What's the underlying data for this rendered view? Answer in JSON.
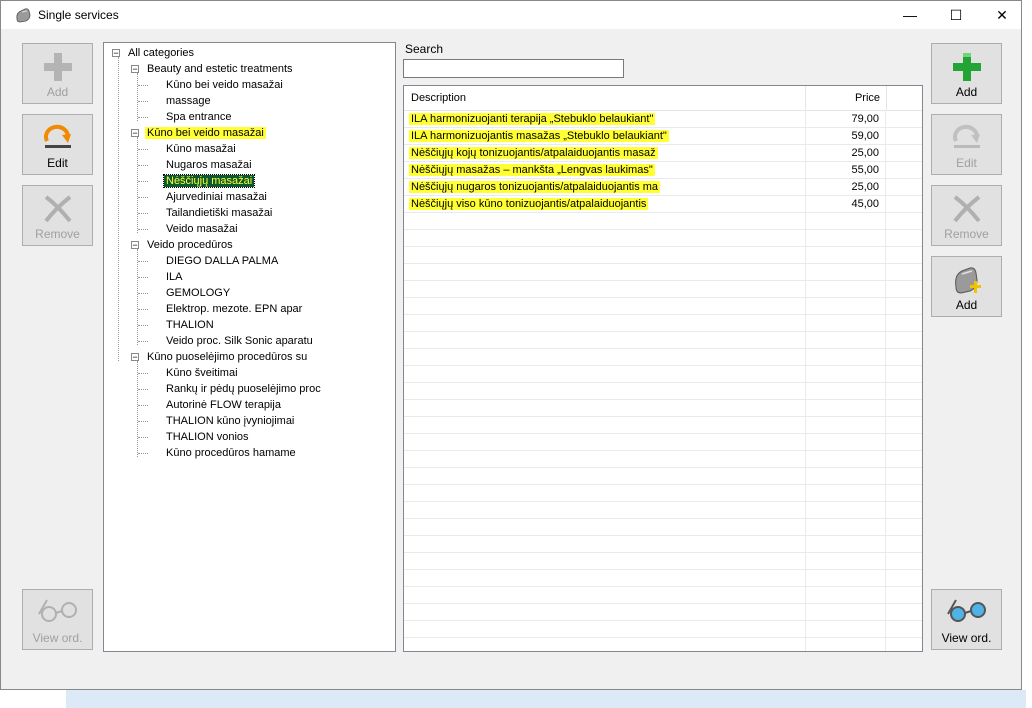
{
  "window": {
    "title": "Single services",
    "controls": {
      "minimize": "—",
      "maximize": "☐",
      "close": "✕"
    }
  },
  "left_buttons": {
    "add": "Add",
    "edit": "Edit",
    "remove": "Remove",
    "view_ord": "View ord."
  },
  "right_buttons": {
    "add": "Add",
    "edit": "Edit",
    "remove": "Remove",
    "add_item": "Add",
    "view_ord": "View ord."
  },
  "tree": {
    "root": "All categories",
    "groups": [
      {
        "label": "Beauty and estetic treatments",
        "children": [
          "Kūno bei veido masažai",
          "massage",
          "Spa entrance"
        ]
      },
      {
        "label": "Kūno bei veido masažai",
        "children": [
          "Kūno masažai",
          "Nugaros masažai",
          "Nėščiųjų masažai",
          "Ajurvediniai masažai",
          "Tailandietiški masažai",
          "Veido masažai"
        ]
      },
      {
        "label": "Veido procedūros",
        "children": [
          "DIEGO DALLA PALMA",
          "ILA",
          "GEMOLOGY",
          "Elektrop. mezote. EPN apar",
          "THALION",
          "Veido proc. Silk Sonic aparatu"
        ]
      },
      {
        "label": "Kūno puoselėjimo procedūros su",
        "children": [
          "Kūno šveitimai",
          "Rankų ir pėdų puoselėjimo proc",
          "Autorinė FLOW terapija",
          "THALION kūno įvyniojimai",
          "THALION vonios",
          "Kūno procedūros hamame"
        ]
      }
    ],
    "selected": "Nėščiųjų masažai"
  },
  "search": {
    "label": "Search",
    "value": ""
  },
  "grid": {
    "columns": {
      "description": "Description",
      "price": "Price"
    },
    "rows": [
      {
        "description": "ILA harmonizuojanti terapija „Stebuklo belaukiant\"",
        "price": "79,00"
      },
      {
        "description": "ILA harmonizuojantis masažas „Stebuklo belaukiant\"",
        "price": "59,00"
      },
      {
        "description": "Nėščiųjų kojų tonizuojantis/atpalaiduojantis masaž",
        "price": "25,00"
      },
      {
        "description": "Nėščiųjų masažas – mankšta „Lengvas laukimas\"",
        "price": "55,00"
      },
      {
        "description": "Nėščiųjų nugaros tonizuojantis/atpalaiduojantis ma",
        "price": "25,00"
      },
      {
        "description": "Nėščiųjų viso kūno tonizuojantis/atpalaiduojantis",
        "price": "45,00"
      }
    ]
  },
  "colors": {
    "highlight": "#ffff33",
    "selected_bg": "#0b5a2e",
    "plus_green": "#22a535",
    "edit_orange": "#f08a00"
  }
}
